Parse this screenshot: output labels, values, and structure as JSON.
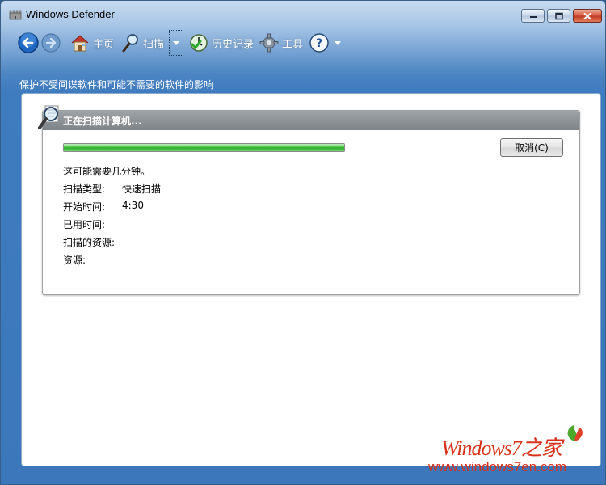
{
  "window": {
    "title": "Windows Defender"
  },
  "toolbar": {
    "home_label": "主页",
    "scan_label": "扫描",
    "history_label": "历史记录",
    "tools_label": "工具"
  },
  "banner": "保护不受间谍软件和可能不需要的软件的影响",
  "scan_panel": {
    "title": "正在扫描计算机...",
    "cancel_label": "取消(C)",
    "progress": 1.0,
    "note": "这可能需要几分钟。",
    "rows": [
      {
        "label": "扫描类型:",
        "value": "快速扫描"
      },
      {
        "label": "开始时间:",
        "value": "4:30"
      },
      {
        "label": "已用时间:",
        "value": ""
      },
      {
        "label": "扫描的资源:",
        "value": ""
      },
      {
        "label": "资源:",
        "value": ""
      }
    ]
  },
  "watermark": {
    "logo": "Windows7之家",
    "url": "www.windows7en.com"
  },
  "colors": {
    "accent": "#3f7bbf",
    "progress_green": "#3ec23a",
    "close_red": "#c0381f",
    "watermark_red": "#d9311a"
  },
  "icons": [
    "back-arrow-icon",
    "forward-arrow-icon",
    "home-icon",
    "magnifier-icon",
    "dropdown-arrow-icon",
    "history-clock-icon",
    "gear-icon",
    "help-icon"
  ]
}
